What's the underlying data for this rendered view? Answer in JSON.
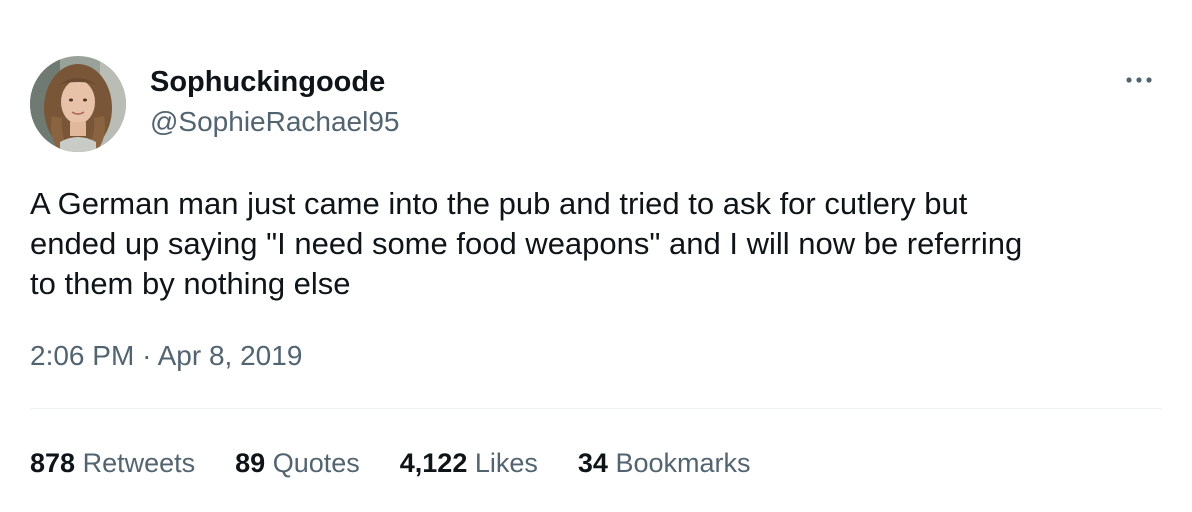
{
  "user": {
    "display_name": "Sophuckingoode",
    "handle": "@SophieRachael95"
  },
  "icons": {
    "more": "more-horizontal-icon"
  },
  "tweet": {
    "lines": [
      "A German man just came into the pub and tried to ask for cutlery but",
      "ended up saying \"I need some food weapons\" and I will now be referring",
      "to them by nothing else"
    ]
  },
  "meta": {
    "time": "2:06 PM",
    "separator": "·",
    "date": "Apr 8, 2019"
  },
  "stats": [
    {
      "count": "878",
      "label": "Retweets"
    },
    {
      "count": "89",
      "label": "Quotes"
    },
    {
      "count": "4,122",
      "label": "Likes"
    },
    {
      "count": "34",
      "label": "Bookmarks"
    }
  ],
  "colors": {
    "text_primary": "#0f1419",
    "text_secondary": "#536471",
    "divider": "#eff3f4"
  }
}
